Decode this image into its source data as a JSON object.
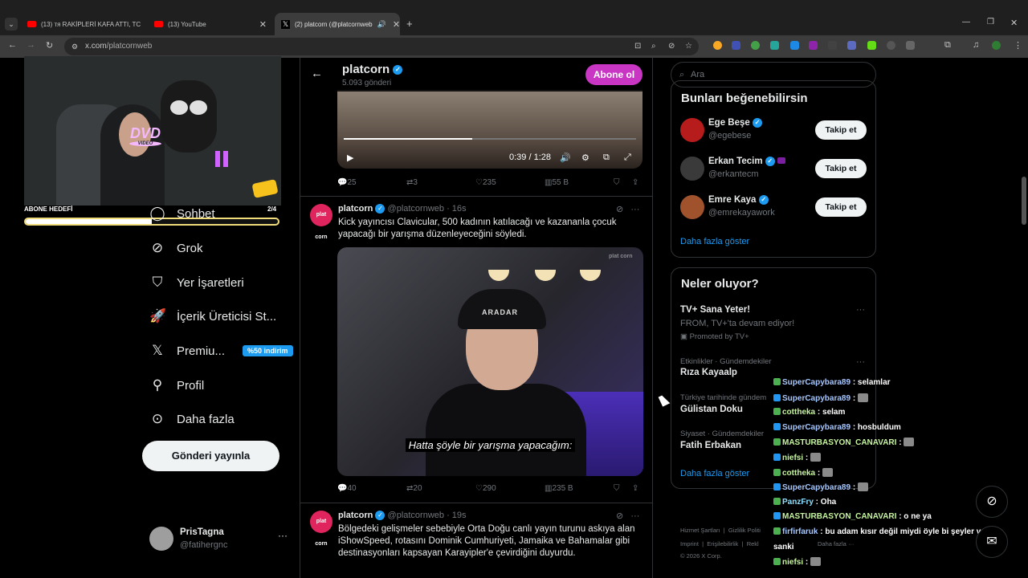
{
  "browser": {
    "tabs": [
      {
        "title": "(13) тя RAKİPLERİ KAFA ATTI, TC",
        "active": false
      },
      {
        "title": "(13) YouTube",
        "active": false
      },
      {
        "title": "(2) platcorn (@platcornweb",
        "active": true
      }
    ],
    "new_tab": "+",
    "url_host": "x.com",
    "url_path": "/platcornweb"
  },
  "stream_overlay": {
    "goal_label": "ABONE HEDEFİ",
    "goal_count": "2/4",
    "goal_progress": 0.5,
    "dvd_text": "DVD",
    "dvd_sub": "VIDEO"
  },
  "sidebar": {
    "items": [
      {
        "label": "Sohbet",
        "icon": "chat-icon"
      },
      {
        "label": "Grok",
        "icon": "grok-icon"
      },
      {
        "label": "Yer İşaretleri",
        "icon": "bookmark-icon"
      },
      {
        "label": "İçerik Üreticisi St...",
        "icon": "rocket-icon"
      },
      {
        "label": "Premiu...",
        "icon": "x-logo-icon",
        "badge": "%50 indirim"
      },
      {
        "label": "Profil",
        "icon": "person-icon"
      },
      {
        "label": "Daha fazla",
        "icon": "more-circle-icon"
      }
    ],
    "post_button": "Gönderi yayınla",
    "account": {
      "name": "PrisTagna",
      "handle": "@fatihergnc"
    }
  },
  "profile_header": {
    "name": "platcorn",
    "post_count": "5.093 gönderi",
    "subscribe": "Abone ol"
  },
  "feed": {
    "video1": {
      "time": "0:39 / 1:28",
      "progress": 0.44
    },
    "post1_stats": {
      "replies": "25",
      "reposts": "3",
      "likes": "235",
      "views": "55 B"
    },
    "post2": {
      "avatar_text": "plat corn",
      "name": "platcorn",
      "handle": "@platcornweb",
      "time": "16s",
      "text": "Kick yayıncısı Clavicular, 500 kadının katılacağı ve kazananla çocuk yapacağı bir yarışma düzenleyeceğini söyledi.",
      "video_subtitle": "Hatta şöyle bir yarışma yapacağım:",
      "watermark": "plat corn",
      "cap_text": "ARADAR",
      "stats": {
        "replies": "40",
        "reposts": "20",
        "likes": "290",
        "views": "235 B"
      }
    },
    "post3": {
      "avatar_text": "plat corn",
      "name": "platcorn",
      "handle": "@platcornweb",
      "time": "19s",
      "text": "Bölgedeki gelişmeler sebebiyle Orta Doğu canlı yayın turunu askıya alan iShowSpeed, rotasını Dominik Cumhuriyeti, Jamaika ve Bahamalar gibi destinasyonları kapsayan Karayipler'e çevirdiğini duyurdu."
    }
  },
  "right": {
    "search_placeholder": "Ara",
    "suggestions_title": "Bunları beğenebilirsin",
    "suggestions": [
      {
        "name": "Ege Beşe",
        "handle": "@egebese",
        "follow": "Takip et",
        "color": "#b71c1c"
      },
      {
        "name": "Erkan Tecim",
        "handle": "@erkantecm",
        "follow": "Takip et",
        "color": "#3a3a3a"
      },
      {
        "name": "Emre Kaya",
        "handle": "@emrekayawork",
        "follow": "Takip et",
        "color": "#a0522d"
      }
    ],
    "show_more": "Daha fazla göster",
    "trends_title": "Neler oluyor?",
    "trends": [
      {
        "meta": "",
        "title": "TV+ Sana Yeter!",
        "sub": "FROM, TV+'ta devam ediyor!",
        "promo": "Promoted by TV+"
      },
      {
        "meta": "Etkinlikler · Gündemdekiler",
        "title": "Rıza Kayaalp"
      },
      {
        "meta": "Türkiye tarihinde gündem",
        "title": "Gülistan Doku"
      },
      {
        "meta": "Siyaset · Gündemdekiler",
        "title": "Fatih Erbakan"
      }
    ],
    "trends_more": "Daha fazla göster",
    "footer": {
      "line1": [
        "Hizmet Şartları",
        "Gizlilik Politi"
      ],
      "line2": [
        "Imprint",
        "Erişilebilirlik",
        "Rekl",
        "Daha fazla ···"
      ],
      "copyright": "© 2026 X Corp."
    }
  },
  "chat": [
    {
      "user": "SuperCapybara89",
      "msg": "selamlar",
      "cls": "u"
    },
    {
      "user": "SuperCapybara89",
      "msg": "",
      "emote": true,
      "cls": "u"
    },
    {
      "user": "cottheka",
      "msg": "selam",
      "cls": "u2"
    },
    {
      "user": "SuperCapybara89",
      "msg": "hosbuldum",
      "cls": "u"
    },
    {
      "user": "MASTURBASYON_CANAVARI",
      "msg": "",
      "emote": true,
      "cls": "u2"
    },
    {
      "user": "niefsi",
      "msg": "",
      "emote": true,
      "cls": "u2"
    },
    {
      "user": "cottheka",
      "msg": "",
      "emote": true,
      "cls": "u2"
    },
    {
      "user": "SuperCapybara89",
      "msg": "",
      "emote": true,
      "cls": "u"
    },
    {
      "user": "PanzFry",
      "msg": "Oha",
      "cls": "u3"
    },
    {
      "user": "MASTURBASYON_CANAVARI",
      "msg": "o ne ya",
      "cls": "u2"
    },
    {
      "user": "firfirfaruk",
      "msg": "bu adam kısır değil miydi öyle bi şeyler vardı",
      "cls": "u"
    },
    {
      "user": "sanki",
      "msg": "",
      "cls": "msg"
    },
    {
      "user": "niefsi",
      "msg": "",
      "emote": true,
      "cls": "u2"
    }
  ],
  "colors": {
    "accent": "#1d9bf0",
    "subscribe": "#c936c4",
    "goal_border": "#f0dc7a"
  }
}
